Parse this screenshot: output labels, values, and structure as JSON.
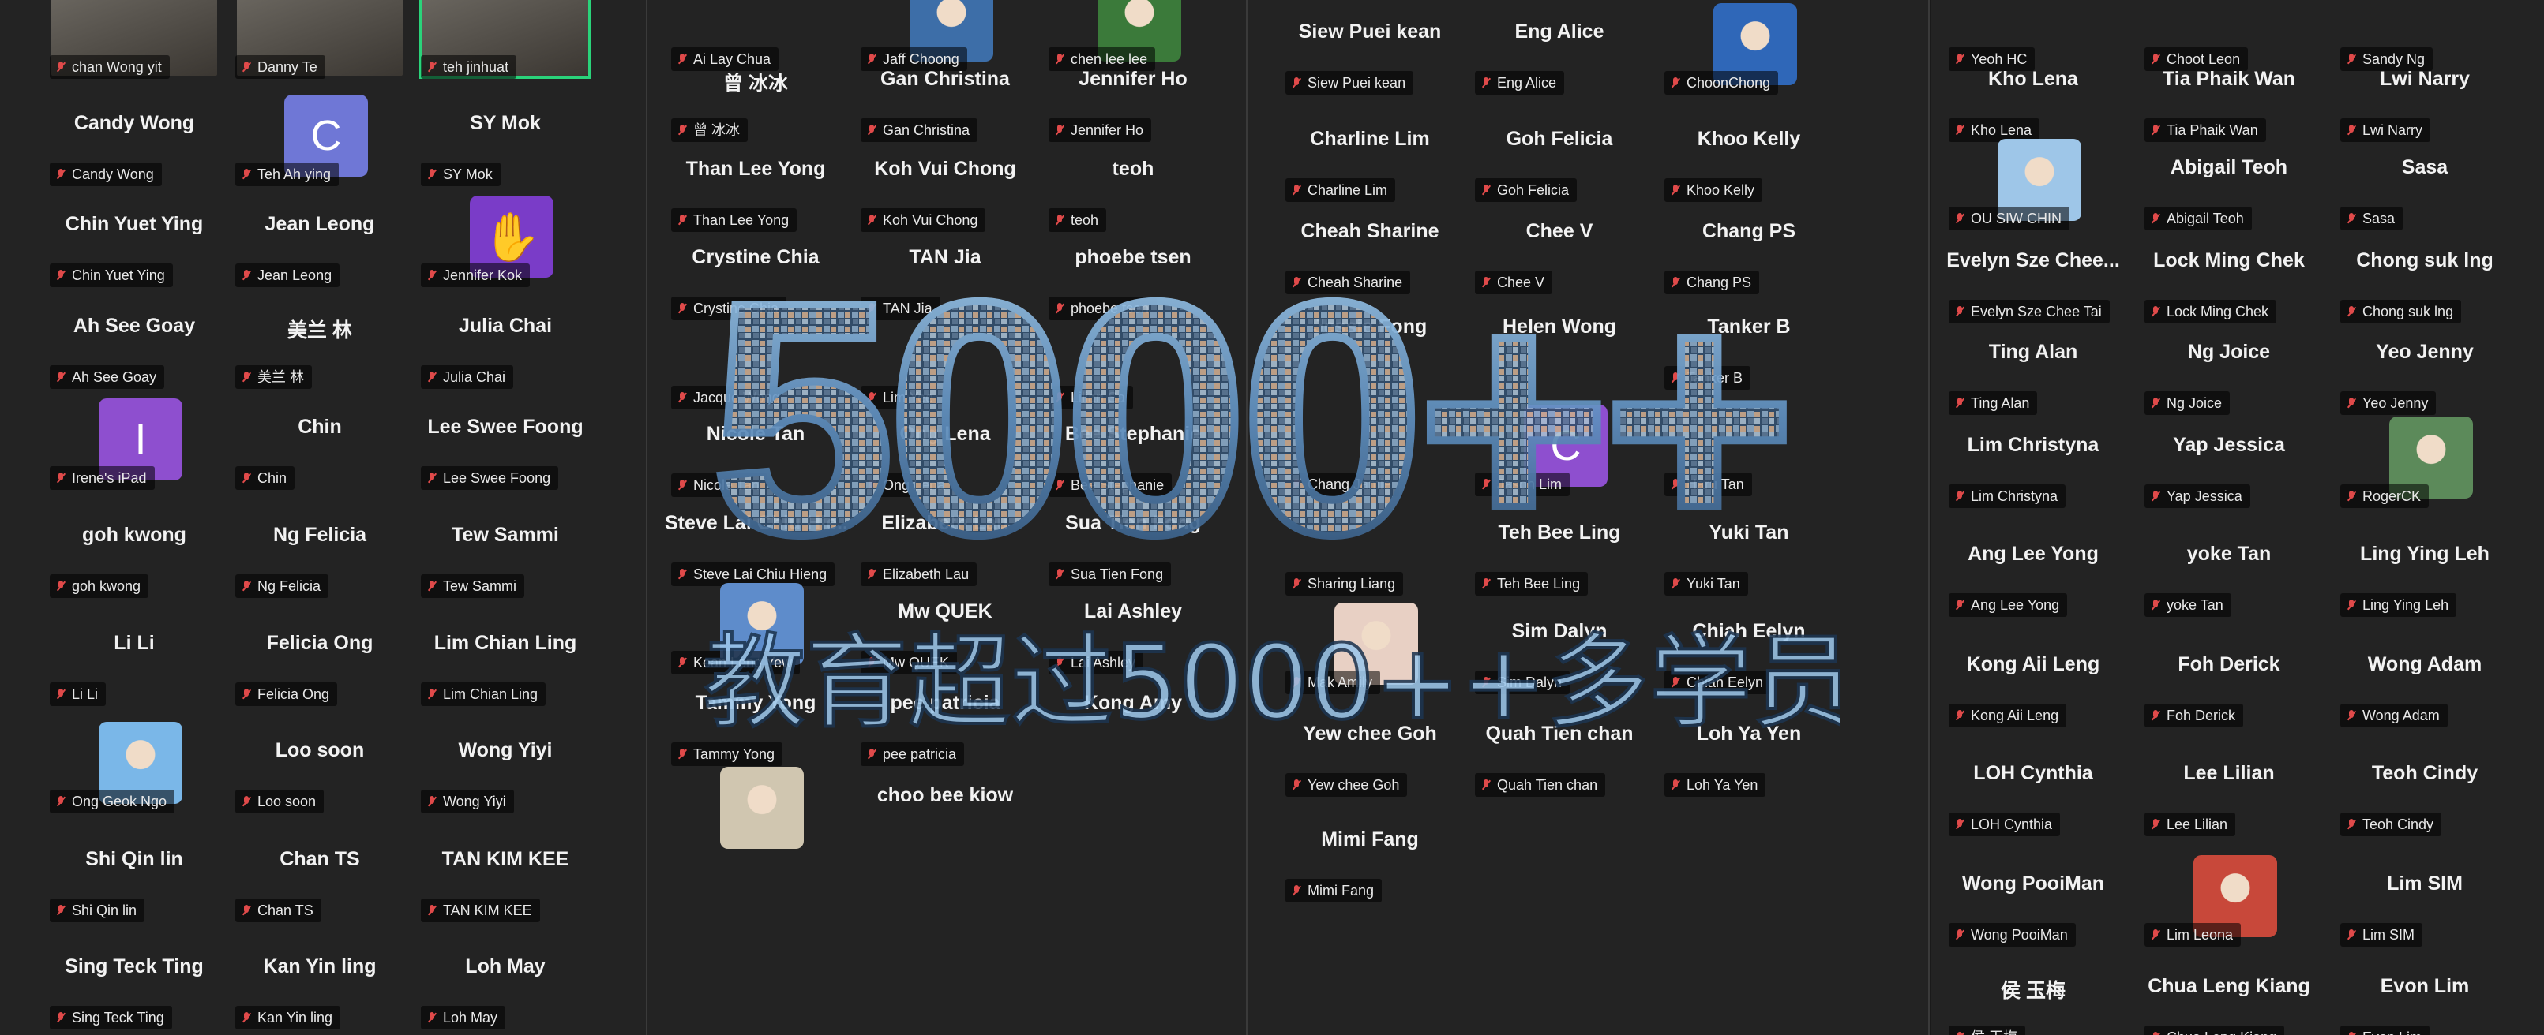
{
  "colors": {
    "background": "#232323",
    "name": "#f2f2f2",
    "mic_muted": "#e04a4a",
    "active_speaker": "#2ad37a",
    "overlay_blue": "#7fb6e6"
  },
  "promo": {
    "number": "5000++",
    "subtitle": "教育超过5000++多学员"
  },
  "panels": [
    {
      "tiles": [
        {
          "label": "chan Wong yit",
          "avatar": "video"
        },
        {
          "label": "Danny Te",
          "avatar": "video"
        },
        {
          "label": "teh jinhuat",
          "avatar": "video",
          "active": true
        },
        {
          "name": "Candy Wong",
          "label": "Candy Wong"
        },
        {
          "label": "Teh Ah ying",
          "avatar": "letter",
          "letter": "C",
          "color": "#6f77d6"
        },
        {
          "name": "SY Mok",
          "label": "SY Mok"
        },
        {
          "name": "Chin Yuet Ying",
          "label": "Chin Yuet Ying"
        },
        {
          "name": "Jean Leong",
          "label": "Jean Leong"
        },
        {
          "label": "Jennifer Kok",
          "avatar": "hamsa-icon",
          "color": "#7a3cc8"
        },
        {
          "name": "Ah See Goay",
          "label": "Ah See Goay"
        },
        {
          "name": "美兰 林",
          "label": "美兰 林"
        },
        {
          "name": "Julia Chai",
          "label": "Julia Chai"
        },
        {
          "label": "Irene's iPad",
          "avatar": "letter",
          "letter": "I",
          "color": "#8e4fcf"
        },
        {
          "name": "Chin",
          "label": "Chin"
        },
        {
          "name": "Lee Swee Foong",
          "label": "Lee Swee Foong"
        },
        {
          "name": "goh kwong",
          "label": "goh kwong"
        },
        {
          "name": "Ng Felicia",
          "label": "Ng Felicia"
        },
        {
          "name": "Tew Sammi",
          "label": "Tew Sammi"
        },
        {
          "name": "Li Li",
          "label": "Li Li"
        },
        {
          "name": "Felicia Ong",
          "label": "Felicia Ong"
        },
        {
          "name": "Lim Chian Ling",
          "label": "Lim Chian Ling"
        },
        {
          "label": "Ong Geok Ngo",
          "avatar": "sunglasses-photo",
          "color": "#7ab7e8"
        },
        {
          "name": "Loo soon",
          "label": "Loo soon"
        },
        {
          "name": "Wong Yiyi",
          "label": "Wong Yiyi"
        },
        {
          "name": "Shi Qin lin",
          "label": "Shi Qin lin"
        },
        {
          "name": "Chan TS",
          "label": "Chan TS"
        },
        {
          "name": "TAN KIM KEE",
          "label": "TAN KIM KEE"
        },
        {
          "name": "Sing Teck Ting",
          "label": "Sing Teck Ting"
        },
        {
          "name": "Kan Yin ling",
          "label": "Kan Yin ling"
        },
        {
          "name": "Loh May",
          "label": "Loh May"
        }
      ]
    },
    {
      "tiles": [
        {
          "label": "Ai Lay Chua"
        },
        {
          "label": "Jaff Choong",
          "avatar": "photo",
          "color": "#3d6ea8"
        },
        {
          "label": "chen lee lee",
          "avatar": "photo",
          "color": "#3b7a3a"
        },
        {
          "name": "曾 冰冰",
          "label": "曾 冰冰"
        },
        {
          "name": "Gan Christina",
          "label": "Gan Christina"
        },
        {
          "name": "Jennifer Ho",
          "label": "Jennifer Ho"
        },
        {
          "name": "Than Lee Yong",
          "label": "Than Lee Yong"
        },
        {
          "name": "Koh Vui Chong",
          "label": "Koh Vui Chong"
        },
        {
          "name": "teoh",
          "label": "teoh"
        },
        {
          "name": "Crystine Chia",
          "label": "Crystine Chia"
        },
        {
          "name": "TAN Jia",
          "label": "TAN Jia"
        },
        {
          "name": "phoebe tsen",
          "label": "phoebe tsen"
        },
        {
          "label": "Jacque Wong"
        },
        {
          "label": "Lim Yee"
        },
        {
          "label": "Lilian Sa"
        },
        {
          "name": "Nicole Tan",
          "label": "Nicole Tan"
        },
        {
          "name": "Ong Lena",
          "label": "Ong Lena"
        },
        {
          "name": "Bee Stephanie",
          "label": "Bee Stephanie"
        },
        {
          "name": "Steve Lai Chiu Hie...",
          "label": "Steve Lai Chiu Hieng"
        },
        {
          "name": "Elizabeth Lau",
          "label": "Elizabeth Lau"
        },
        {
          "name": "Sua Tien Fong",
          "label": "Sua Tien Fong"
        },
        {
          "label": "Kean Leng Yew",
          "avatar": "photo",
          "color": "#5e8ccb"
        },
        {
          "name": "Mw QUEK",
          "label": "Mw QUEK"
        },
        {
          "name": "Lai Ashley",
          "label": "Lai Ashley"
        },
        {
          "name": "Tammy Yong",
          "label": "Tammy Yong"
        },
        {
          "name": "pee patricia",
          "label": "pee patricia"
        },
        {
          "name": "Kong Amy"
        },
        {
          "avatar": "photo",
          "color": "#d0c6b0"
        },
        {
          "name": "choo bee kiow"
        }
      ]
    },
    {
      "tiles": [
        {
          "name": "Siew Puei kean",
          "label": "Siew Puei kean"
        },
        {
          "name": "Eng Alice",
          "label": "Eng Alice"
        },
        {
          "label": "ChoonChong",
          "avatar": "photo",
          "color": "#2f67b8"
        },
        {
          "name": "Charline Lim",
          "label": "Charline Lim"
        },
        {
          "name": "Goh Felicia",
          "label": "Goh Felicia"
        },
        {
          "name": "Khoo Kelly",
          "label": "Khoo Kelly"
        },
        {
          "name": "Cheah Sharine",
          "label": "Cheah Sharine"
        },
        {
          "name": "Chee V",
          "label": "Chee V"
        },
        {
          "name": "Chang PS",
          "label": "Chang PS"
        },
        {
          "name": "Jessie Fong"
        },
        {
          "name": "Helen Wong"
        },
        {
          "name": "Tanker B",
          "label": "Tanker B"
        },
        {
          "label": "Chang Jamie"
        },
        {
          "label": "Jason Lim",
          "avatar": "letter",
          "letter": "C",
          "color": "#8e4fcf"
        },
        {
          "label": "Haru Tan"
        },
        {
          "label": "Sharing Liang"
        },
        {
          "name": "Teh Bee Ling",
          "label": "Teh Bee Ling"
        },
        {
          "name": "Yuki Tan",
          "label": "Yuki Tan"
        },
        {
          "label": "Mak Amily",
          "avatar": "photo",
          "color": "#e8d0c4"
        },
        {
          "name": "Sim Dalyn",
          "label": "Sim Dalyn"
        },
        {
          "name": "Chiah Eelyn",
          "label": "Chiah Eelyn"
        },
        {
          "name": "Yew chee Goh",
          "label": "Yew chee Goh"
        },
        {
          "name": "Quah Tien chan",
          "label": "Quah Tien chan"
        },
        {
          "name": "Loh Ya Yen",
          "label": "Loh Ya Yen"
        },
        {
          "name": "Mimi Fang",
          "label": "Mimi Fang"
        }
      ]
    },
    {
      "tiles": [
        {
          "label": "Yeoh HC"
        },
        {
          "label": "Choot Leon"
        },
        {
          "label": "Sandy Ng"
        },
        {
          "name": "Kho Lena",
          "label": "Kho Lena"
        },
        {
          "name": "Tia Phaik Wan",
          "label": "Tia Phaik Wan"
        },
        {
          "name": "Lwi Narry",
          "label": "Lwi Narry"
        },
        {
          "label": "OU SIW CHIN",
          "avatar": "photo",
          "color": "#9ec6e8"
        },
        {
          "name": "Abigail Teoh",
          "label": "Abigail Teoh"
        },
        {
          "name": "Sasa",
          "label": "Sasa"
        },
        {
          "name": "Evelyn Sze Chee...",
          "label": "Evelyn Sze Chee Tai"
        },
        {
          "name": "Lock Ming Chek",
          "label": "Lock Ming Chek"
        },
        {
          "name": "Chong suk lng",
          "label": "Chong suk lng"
        },
        {
          "name": "Ting Alan",
          "label": "Ting Alan"
        },
        {
          "name": "Ng Joice",
          "label": "Ng Joice"
        },
        {
          "name": "Yeo Jenny",
          "label": "Yeo Jenny"
        },
        {
          "name": "Lim Christyna",
          "label": "Lim Christyna"
        },
        {
          "name": "Yap Jessica",
          "label": "Yap Jessica"
        },
        {
          "label": "RogerCK",
          "avatar": "photo",
          "color": "#5c8a5a"
        },
        {
          "name": "Ang Lee Yong",
          "label": "Ang Lee Yong"
        },
        {
          "name": "yoke Tan",
          "label": "yoke Tan"
        },
        {
          "name": "Ling Ying Leh",
          "label": "Ling Ying Leh"
        },
        {
          "name": "Kong Aii Leng",
          "label": "Kong Aii Leng"
        },
        {
          "name": "Foh Derick",
          "label": "Foh Derick"
        },
        {
          "name": "Wong Adam",
          "label": "Wong Adam"
        },
        {
          "name": "LOH Cynthia",
          "label": "LOH Cynthia"
        },
        {
          "name": "Lee Lilian",
          "label": "Lee Lilian"
        },
        {
          "name": "Teoh Cindy",
          "label": "Teoh Cindy"
        },
        {
          "name": "Wong PooiMan",
          "label": "Wong PooiMan"
        },
        {
          "label": "Lim Leona",
          "avatar": "photo",
          "color": "#c8483a"
        },
        {
          "name": "Lim SIM",
          "label": "Lim SIM"
        },
        {
          "name": "侯 玉梅",
          "label": "侯 玉梅"
        },
        {
          "name": "Chua Leng Kiang",
          "label": "Chua Leng Kiang"
        },
        {
          "name": "Evon Lim",
          "label": "Evon Lim"
        }
      ]
    }
  ]
}
